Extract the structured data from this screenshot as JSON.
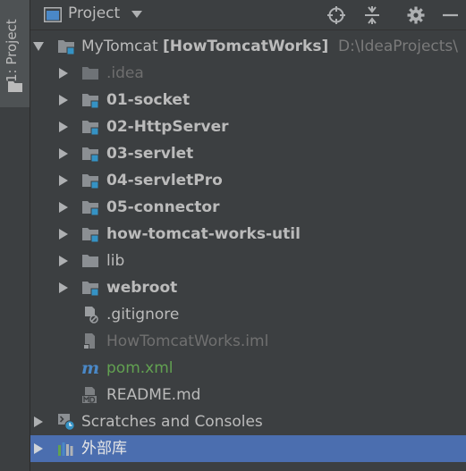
{
  "side_strip": {
    "tab_label": "1: Project"
  },
  "header": {
    "title": "Project"
  },
  "tree": {
    "root": {
      "name": "MyTomcat",
      "module": "[HowTomcatWorks]",
      "path": "D:\\IdeaProjects\\"
    },
    "items": [
      {
        "label": ".idea"
      },
      {
        "label": "01-socket"
      },
      {
        "label": "02-HttpServer"
      },
      {
        "label": "03-servlet"
      },
      {
        "label": "04-servletPro"
      },
      {
        "label": "05-connector"
      },
      {
        "label": "how-tomcat-works-util"
      },
      {
        "label": "lib"
      },
      {
        "label": "webroot"
      },
      {
        "label": ".gitignore"
      },
      {
        "label": "HowTomcatWorks.iml"
      },
      {
        "label": "pom.xml"
      },
      {
        "label": "README.md"
      }
    ],
    "scratches": {
      "label": "Scratches and Consoles"
    },
    "libraries": {
      "label": "外部库"
    }
  },
  "colors": {
    "background": "#3c3f41",
    "selection": "#4b6eaf",
    "folder": "#8b8f93",
    "module_badge": "#3592c4",
    "maven_green": "#62a151"
  }
}
